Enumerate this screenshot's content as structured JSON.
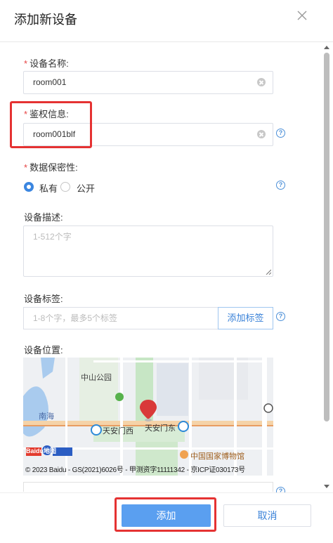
{
  "dialog": {
    "title": "添加新设备",
    "close_icon": "close-icon"
  },
  "form": {
    "name": {
      "label": "设备名称:",
      "required": "*",
      "value": "room001"
    },
    "auth": {
      "label": "鉴权信息:",
      "required": "*",
      "value": "room001blf",
      "help": "?"
    },
    "privacy": {
      "label": "数据保密性:",
      "required": "*",
      "options": [
        "私有",
        "公开"
      ],
      "selected": "私有",
      "help": "?"
    },
    "description": {
      "label": "设备描述:",
      "placeholder": "1-512个字"
    },
    "tags": {
      "label": "设备标签:",
      "placeholder": "1-8个字，最多5个标签",
      "add_button": "添加标签",
      "help": "?"
    },
    "location": {
      "label": "设备位置:",
      "map": {
        "places": [
          "中山公园",
          "南海",
          "天安门西",
          "天安门东",
          "中国国家博物馆"
        ],
        "brand": "Baidu地图",
        "copyright": "© 2023 Baidu - GS(2021)6026号 - 甲测资字11111342 - 京ICP证030173号"
      },
      "help": "?"
    }
  },
  "footer": {
    "confirm_label": "添加",
    "cancel_label": "取消"
  },
  "colors": {
    "primary": "#5a9ff0",
    "required": "#e64545",
    "highlight": "#e53232"
  }
}
